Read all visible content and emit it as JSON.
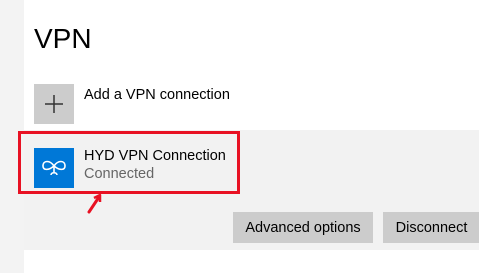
{
  "page": {
    "title": "VPN"
  },
  "add_connection": {
    "label": "Add a VPN connection",
    "icon": "plus-icon"
  },
  "vpn_connection": {
    "name": "HYD VPN Connection",
    "status": "Connected",
    "icon": "vpn-link-icon",
    "accent_color": "#0078d7"
  },
  "actions": {
    "advanced_label": "Advanced options",
    "disconnect_label": "Disconnect"
  },
  "annotation": {
    "highlight_color": "#e81123"
  }
}
